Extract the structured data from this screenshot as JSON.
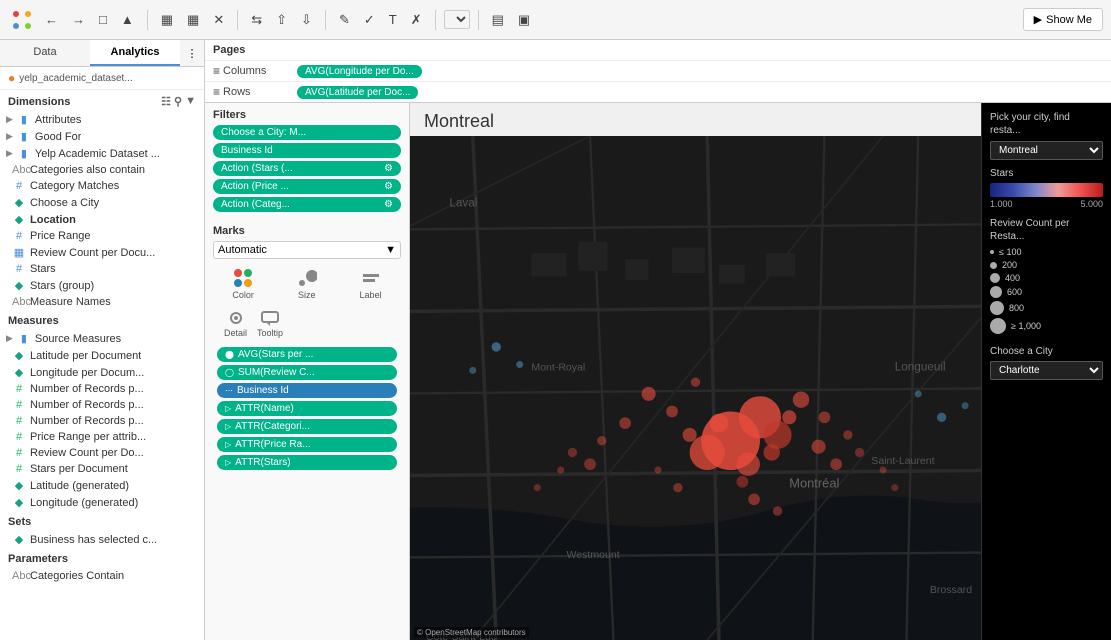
{
  "toolbar": {
    "show_me_label": "Show Me"
  },
  "tabs": {
    "data_label": "Data",
    "analytics_label": "Analytics"
  },
  "datasource": {
    "name": "yelp_academic_dataset..."
  },
  "dimensions": {
    "header": "Dimensions",
    "items": [
      {
        "name": "Attributes",
        "icon": "▶",
        "type": "folder"
      },
      {
        "name": "Good For",
        "icon": "▶",
        "type": "folder"
      },
      {
        "name": "Yelp Academic Dataset ...",
        "icon": "▶",
        "type": "folder"
      },
      {
        "name": "Categories also contain",
        "icon": "Abc",
        "type": "text"
      },
      {
        "name": "Category Matches",
        "icon": "#",
        "type": "number"
      },
      {
        "name": "Choose a City",
        "icon": "⊕",
        "type": "param"
      },
      {
        "name": "Location",
        "icon": "⊕",
        "type": "geo"
      },
      {
        "name": "Price Range",
        "icon": "#",
        "type": "number"
      },
      {
        "name": "Review Count per Docu...",
        "icon": "≡",
        "type": "measure"
      },
      {
        "name": "Stars",
        "icon": "#",
        "type": "number"
      },
      {
        "name": "Stars (group)",
        "icon": "⊕",
        "type": "group"
      },
      {
        "name": "Measure Names",
        "icon": "Abc",
        "type": "text"
      }
    ]
  },
  "measures": {
    "header": "Measures",
    "items": [
      {
        "name": "Source Measures",
        "icon": "▶",
        "type": "folder"
      },
      {
        "name": "Latitude per Document",
        "icon": "⊕",
        "type": "geo"
      },
      {
        "name": "Longitude per Docum...",
        "icon": "⊕",
        "type": "geo"
      },
      {
        "name": "Number of Records p...",
        "icon": "#",
        "type": "number"
      },
      {
        "name": "Number of Records p...",
        "icon": "#",
        "type": "number"
      },
      {
        "name": "Number of Records p...",
        "icon": "#",
        "type": "number"
      },
      {
        "name": "Price Range per attrib...",
        "icon": "#",
        "type": "number"
      },
      {
        "name": "Review Count per Do...",
        "icon": "#",
        "type": "number"
      },
      {
        "name": "Stars per Document",
        "icon": "#",
        "type": "number"
      },
      {
        "name": "Latitude (generated)",
        "icon": "⊕",
        "type": "geo"
      },
      {
        "name": "Longitude (generated)",
        "icon": "⊕",
        "type": "geo"
      }
    ]
  },
  "sets": {
    "header": "Sets",
    "items": [
      {
        "name": "Business has selected c...",
        "icon": "⊕"
      }
    ]
  },
  "parameters": {
    "header": "Parameters",
    "items": [
      {
        "name": "Categories Contain",
        "icon": "Abc"
      }
    ]
  },
  "pages_label": "Pages",
  "columns_label": "Columns",
  "rows_label": "Rows",
  "columns_pill": "AVG(Longitude per Do...",
  "rows_pill": "AVG(Latitude per Doc...",
  "filters": {
    "header": "Filters",
    "items": [
      "Choose a City: M...",
      "Business Id",
      "Action (Stars (... ⚙)",
      "Action (Price ... ⚙)",
      "Action (Categ... ⚙)"
    ]
  },
  "marks": {
    "header": "Marks",
    "type": "Automatic",
    "buttons": [
      "Color",
      "Size",
      "Label",
      "Detail",
      "Tooltip"
    ],
    "pills": [
      {
        "text": "AVG(Stars per ...",
        "type": "teal"
      },
      {
        "text": "SUM(Review C...",
        "type": "teal"
      },
      {
        "text": "Business Id",
        "type": "blue"
      },
      {
        "text": "ATTR(Name)",
        "type": "teal"
      },
      {
        "text": "ATTR(Categori...",
        "type": "teal"
      },
      {
        "text": "ATTR(Price Ra...",
        "type": "teal"
      },
      {
        "text": "ATTR(Stars)",
        "type": "teal"
      }
    ]
  },
  "view": {
    "title": "Montreal"
  },
  "right_panel": {
    "city_prompt": "Pick your city, find resta...",
    "city_value": "Montreal",
    "stars_label": "Stars",
    "stars_min": "1.000",
    "stars_max": "5.000",
    "review_count_label": "Review Count per Resta...",
    "review_items": [
      {
        "label": "≤ 100",
        "size": 4
      },
      {
        "label": "200",
        "size": 6
      },
      {
        "label": "400",
        "size": 9
      },
      {
        "label": "600",
        "size": 11
      },
      {
        "label": "800",
        "size": 13
      },
      {
        "label": "≥ 1,000",
        "size": 15
      }
    ],
    "choose_city_label": "Choose a City",
    "choose_city_value": "Charlotte"
  },
  "osm_credit": "© OpenStreetMap contributors"
}
